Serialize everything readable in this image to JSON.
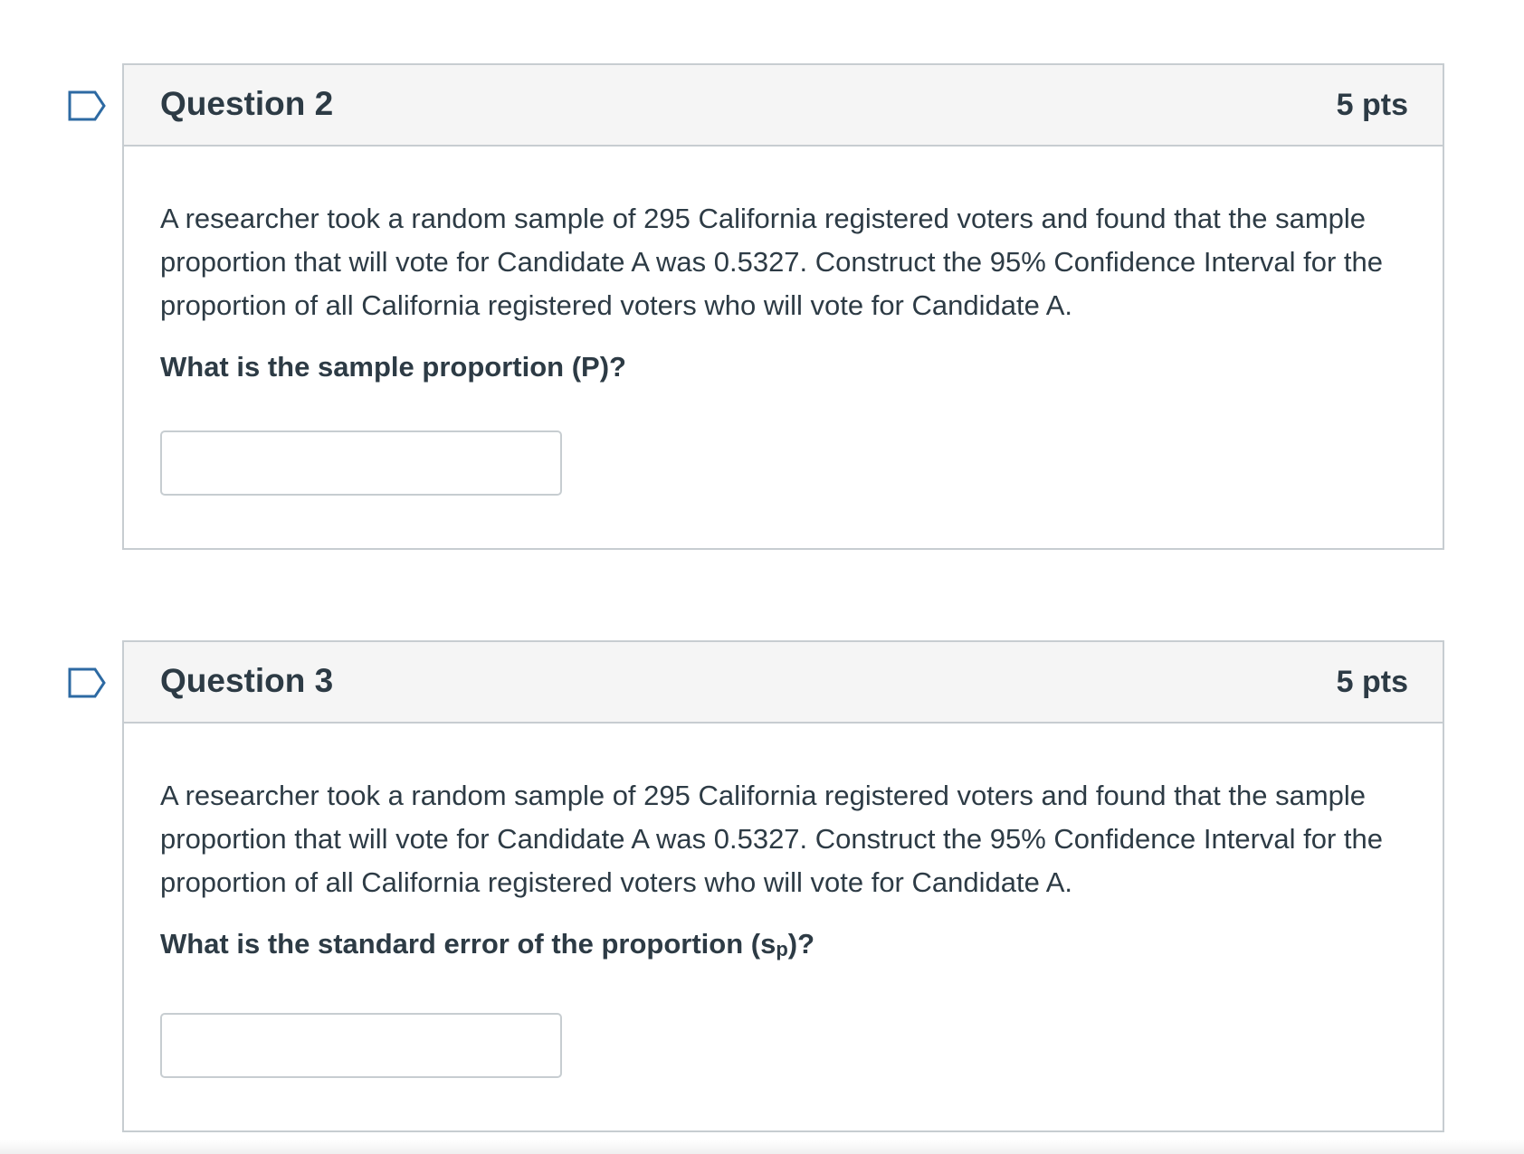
{
  "questions": [
    {
      "title": "Question 2",
      "points": "5 pts",
      "prompt": "A researcher took a random sample of 295 California registered voters and found that the sample proportion that will vote for Candidate A was 0.5327. Construct the 95% Confidence Interval for the proportion of all California registered voters who will vote for Candidate A.",
      "ask": "What is the sample proportion (P)?",
      "answer_value": "",
      "flag_icon": "bookmark-flag-icon"
    },
    {
      "title": "Question 3",
      "points": "5 pts",
      "prompt": "A researcher took a random sample of 295 California registered voters and found that the sample proportion that will vote for Candidate A was 0.5327. Construct the 95% Confidence Interval for the proportion of all California registered voters who will vote for Candidate A.",
      "ask_prefix": "What is the standard error of the proportion (s",
      "ask_sub": "p",
      "ask_suffix": ")?",
      "answer_value": "",
      "flag_icon": "bookmark-flag-icon"
    }
  ],
  "colors": {
    "text": "#2d3b45",
    "border": "#c7cdd1",
    "header_bg": "#f5f5f5",
    "flag": "#2d6aa3"
  }
}
